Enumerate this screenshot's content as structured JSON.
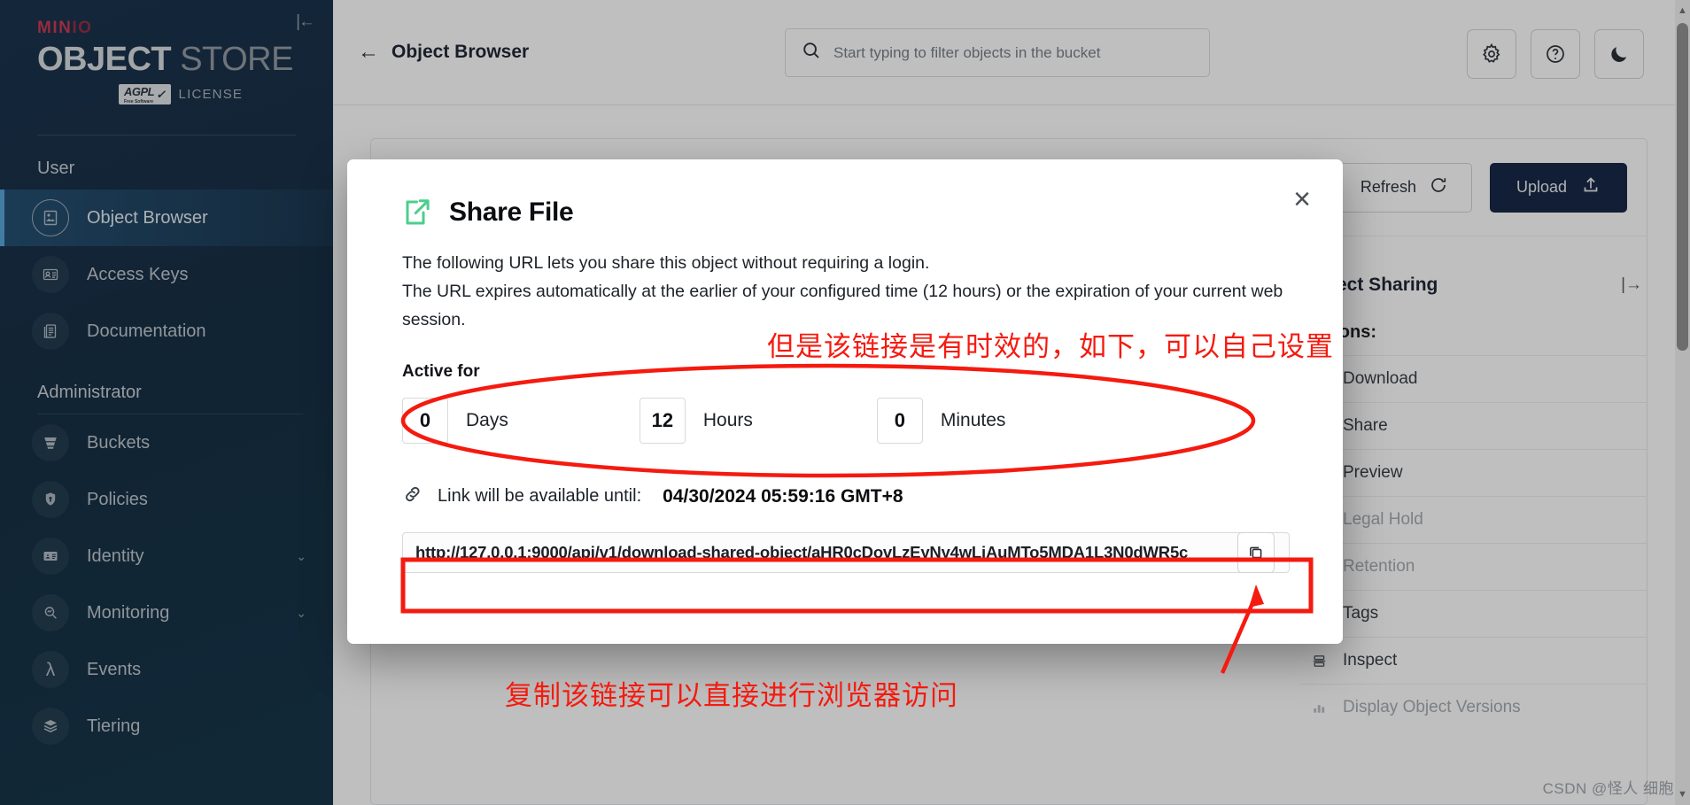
{
  "sidebar": {
    "logo": {
      "brand": "MIN",
      "brand_suffix": "IO",
      "title_bold": "OBJECT",
      "title_light": "STORE",
      "badge": "AGPL",
      "badge_sub": "Free Software",
      "license": "LICENSE"
    },
    "collapse_icon": "collapse-panel-icon",
    "sections": [
      {
        "label": "User",
        "items": [
          {
            "label": "Object Browser",
            "icon": "object-browser-icon",
            "active": true,
            "chevron": ""
          },
          {
            "label": "Access Keys",
            "icon": "access-keys-icon",
            "active": false,
            "chevron": ""
          },
          {
            "label": "Documentation",
            "icon": "documentation-icon",
            "active": false,
            "chevron": ""
          }
        ]
      },
      {
        "label": "Administrator",
        "items": [
          {
            "label": "Buckets",
            "icon": "buckets-icon",
            "active": false,
            "chevron": ""
          },
          {
            "label": "Policies",
            "icon": "policies-icon",
            "active": false,
            "chevron": ""
          },
          {
            "label": "Identity",
            "icon": "identity-icon",
            "active": false,
            "chevron": "⌄"
          },
          {
            "label": "Monitoring",
            "icon": "monitoring-icon",
            "active": false,
            "chevron": "⌄"
          },
          {
            "label": "Events",
            "icon": "events-lambda-icon",
            "active": false,
            "chevron": ""
          },
          {
            "label": "Tiering",
            "icon": "tiering-icon",
            "active": false,
            "chevron": ""
          }
        ]
      }
    ]
  },
  "topbar": {
    "back_icon": "back-arrow-icon",
    "title": "Object Browser",
    "search": {
      "placeholder": "Start typing to filter objects in the bucket",
      "value": "",
      "icon": "search-icon"
    },
    "icons": [
      {
        "name": "gear-icon",
        "label": "Settings"
      },
      {
        "name": "help-circle-icon",
        "label": "Help"
      },
      {
        "name": "moon-icon",
        "label": "Dark mode"
      }
    ]
  },
  "toolbar": {
    "refresh_label": "Refresh",
    "refresh_icon": "refresh-icon",
    "upload_label": "Upload",
    "upload_icon": "upload-icon"
  },
  "object_panel": {
    "title": "Object Sharing",
    "expand_icon": "expand-panel-icon",
    "subtitle": "Actions:",
    "rows": [
      {
        "label": "Download",
        "icon": "download-icon",
        "dim": false
      },
      {
        "label": "Share",
        "icon": "share-icon",
        "dim": false
      },
      {
        "label": "Preview",
        "icon": "preview-icon",
        "dim": false
      },
      {
        "label": "Legal Hold",
        "icon": "legal-hold-icon",
        "dim": true
      },
      {
        "label": "Retention",
        "icon": "retention-icon",
        "dim": true
      },
      {
        "label": "Tags",
        "icon": "tag-icon",
        "dim": false
      },
      {
        "label": "Inspect",
        "icon": "inspect-icon",
        "dim": false
      },
      {
        "label": "Display Object Versions",
        "icon": "versions-icon",
        "dim": true
      }
    ]
  },
  "modal": {
    "icon": "share-file-icon",
    "title": "Share File",
    "close_icon": "close-icon",
    "description_line1": "The following URL lets you share this object without requiring a login.",
    "description_line2": "The URL expires automatically at the earlier of your configured time (12 hours) or the expiration of your current web session.",
    "active_for_label": "Active for",
    "duration": [
      {
        "value": "0",
        "unit": "Days"
      },
      {
        "value": "12",
        "unit": "Hours"
      },
      {
        "value": "0",
        "unit": "Minutes"
      }
    ],
    "until": {
      "icon": "link-icon",
      "label": "Link will be available until:",
      "value": "04/30/2024 05:59:16 GMT+8"
    },
    "url": "http://127.0.0.1:9000/api/v1/download-shared-object/aHR0cDovLzEyNy4wLjAuMTo5MDA1L3N0dWR5c",
    "copy_icon": "copy-icon"
  },
  "annotations": {
    "top_text": "但是该链接是有时效的，如下，可以自己设置",
    "bottom_text": "复制该链接可以直接进行浏览器访问",
    "color": "#f51a0f"
  },
  "watermark": "CSDN @怪人 细胞"
}
